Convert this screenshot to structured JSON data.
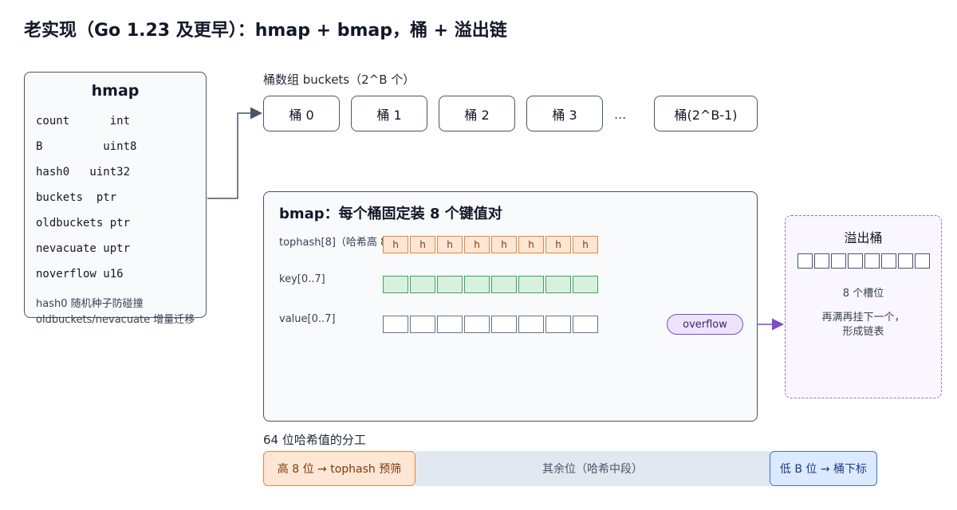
{
  "title": "老实现（Go 1.23 及更早）：hmap + bmap，桶 + 溢出链",
  "hmap": {
    "title": "hmap",
    "fields": [
      "count      int",
      "B         uint8",
      "hash0   uint32",
      "buckets  ptr",
      "oldbuckets ptr",
      "nevacuate uptr",
      "noverflow u16"
    ],
    "notes": [
      "hash0 随机种子防碰撞",
      "oldbuckets/nevacuate 增量迁移"
    ]
  },
  "buckets": {
    "label": "桶数组 buckets（2^B 个）",
    "items": [
      "桶 0",
      "桶 1",
      "桶 2",
      "桶 3"
    ],
    "ellipsis": "...",
    "last": "桶(2^B-1)"
  },
  "bmap": {
    "title": "bmap：每个桶固定装 8 个键值对",
    "tophash_label": "tophash[8]（哈希高 8",
    "tophash_slot": "h",
    "key_label": "key[0..7]",
    "value_label": "value[0..7]",
    "overflow_label": "overflow"
  },
  "overflow_bucket": {
    "title": "溢出桶",
    "slots_note": "8 个槽位",
    "chain_note_1": "再满再挂下一个，",
    "chain_note_2": "形成链表"
  },
  "hash_split": {
    "label": "64 位哈希值的分工",
    "high": "高 8 位 → tophash 预筛",
    "middle": "其余位（哈希中段）",
    "low": "低 B 位 → 桶下标"
  },
  "colors": {
    "tophash": "#e8863c",
    "key": "#3aa65e",
    "overflow": "#7c4dcc",
    "low_bits": "#3b6fd6"
  }
}
